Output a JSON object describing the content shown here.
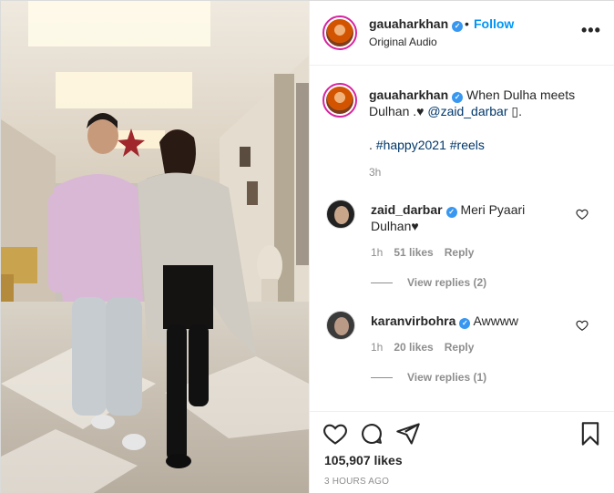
{
  "post": {
    "media_alt": "Reel video frame",
    "header": {
      "username": "gauaharkhan",
      "separator": "•",
      "follow_label": "Follow",
      "audio": "Original Audio",
      "more_icon": "more-options-icon"
    },
    "caption": {
      "username": "gauaharkhan",
      "text_before": "When Dulha meets Dulhan .",
      "heart": "♥",
      "mention": "@zaid_darbar",
      "suffix": " ▯.",
      "tags_prefix": ". ",
      "tag1": "#happy2021",
      "tag2": "#reels",
      "time": "3h"
    },
    "comments": [
      {
        "username": "zaid_darbar",
        "text": "Meri Pyaari Dulhan♥",
        "time": "1h",
        "likes": "51 likes",
        "reply": "Reply",
        "view_replies": "View replies (2)"
      },
      {
        "username": "karanvirbohra",
        "text": "Awwww",
        "time": "1h",
        "likes": "20 likes",
        "reply": "Reply",
        "view_replies": "View replies (1)"
      }
    ],
    "actions": {
      "like_icon": "heart-icon",
      "comment_icon": "comment-icon",
      "share_icon": "share-icon",
      "save_icon": "bookmark-icon"
    },
    "likes": "105,907 likes",
    "posted": "3 HOURS AGO"
  },
  "colors": {
    "link_blue": "#0095f6",
    "verified_blue": "#3897f0",
    "mention": "#00376b",
    "muted": "#8e8e8e"
  }
}
